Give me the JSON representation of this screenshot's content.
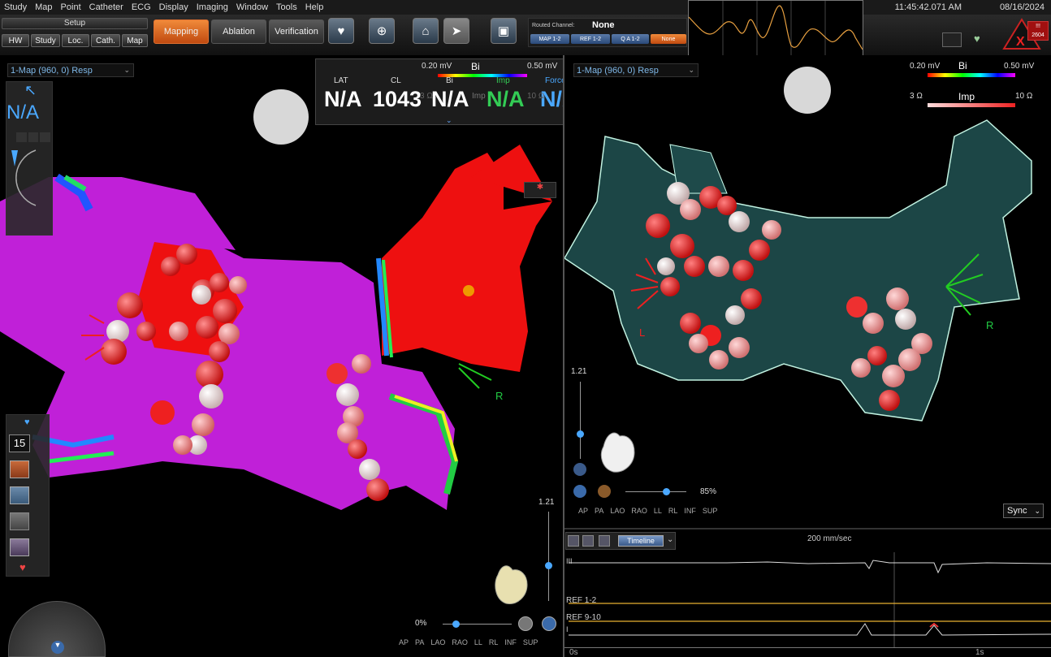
{
  "menu": [
    "Study",
    "Map",
    "Point",
    "Catheter",
    "ECG",
    "Display",
    "Imaging",
    "Window",
    "Tools",
    "Help"
  ],
  "clock": {
    "time": "11:45:42.071 AM",
    "date": "08/16/2024"
  },
  "setup": {
    "label": "Setup",
    "buttons": [
      "HW",
      "Study",
      "Loc.",
      "Cath.",
      "Map"
    ]
  },
  "modes": {
    "mapping": "Mapping",
    "ablation": "Ablation",
    "verification": "Verification"
  },
  "routed": {
    "label": "Routed Channel:",
    "value": "None",
    "buttons": [
      "MAP 1-2",
      "REF 1-2",
      "Q A 1-2",
      "None"
    ]
  },
  "alert_badge": {
    "top": "!!!",
    "bottom": "2604"
  },
  "left_map": {
    "title": "1-Map (960, 0) Resp",
    "stats": {
      "lat_label": "LAT",
      "cl_label": "CL",
      "bi_label": "Bi",
      "imp_label": "Imp",
      "force_label": "Force",
      "lat": "N/A",
      "cl": "1043",
      "bi": "N/A",
      "imp": "N/A",
      "force": "N/A"
    },
    "bi_scale": {
      "min": "0.20 mV",
      "label": "Bi",
      "max": "0.50 mV"
    },
    "imp_scale": {
      "min": "3 Ω",
      "label": "Imp",
      "max": "10 Ω"
    },
    "na_display": "N/A",
    "counter": "15",
    "zoom": "1.21",
    "percent": "0%",
    "views": [
      "AP",
      "PA",
      "LAO",
      "RAO",
      "LL",
      "RL",
      "INF",
      "SUP"
    ],
    "orient_label": "R"
  },
  "right_map": {
    "title": "1-Map (960, 0) Resp",
    "bi_scale": {
      "min": "0.20 mV",
      "label": "Bi",
      "max": "0.50 mV"
    },
    "imp_scale": {
      "min": "3 Ω",
      "label": "Imp",
      "max": "10 Ω"
    },
    "zoom": "1.21",
    "percent": "85%",
    "views": [
      "AP",
      "PA",
      "LAO",
      "RAO",
      "LL",
      "RL",
      "INF",
      "SUP"
    ],
    "sync": "Sync",
    "orient_left": "L",
    "orient_right": "R"
  },
  "ecg": {
    "speed": "200 mm/sec",
    "timeline": "Timeline",
    "channels": [
      "III",
      "REF 1-2",
      "REF 9-10",
      "I"
    ],
    "time_start": "0s",
    "time_mark": "1s"
  },
  "colors": {
    "accent_orange": "#e0661a",
    "lat_text": "#ffffff",
    "imp_green": "#33cc55",
    "force_blue": "#4aa8ff",
    "map_magenta": "#cc33dd",
    "map_red": "#ee1111",
    "shell_teal": "#1e4a4a"
  }
}
